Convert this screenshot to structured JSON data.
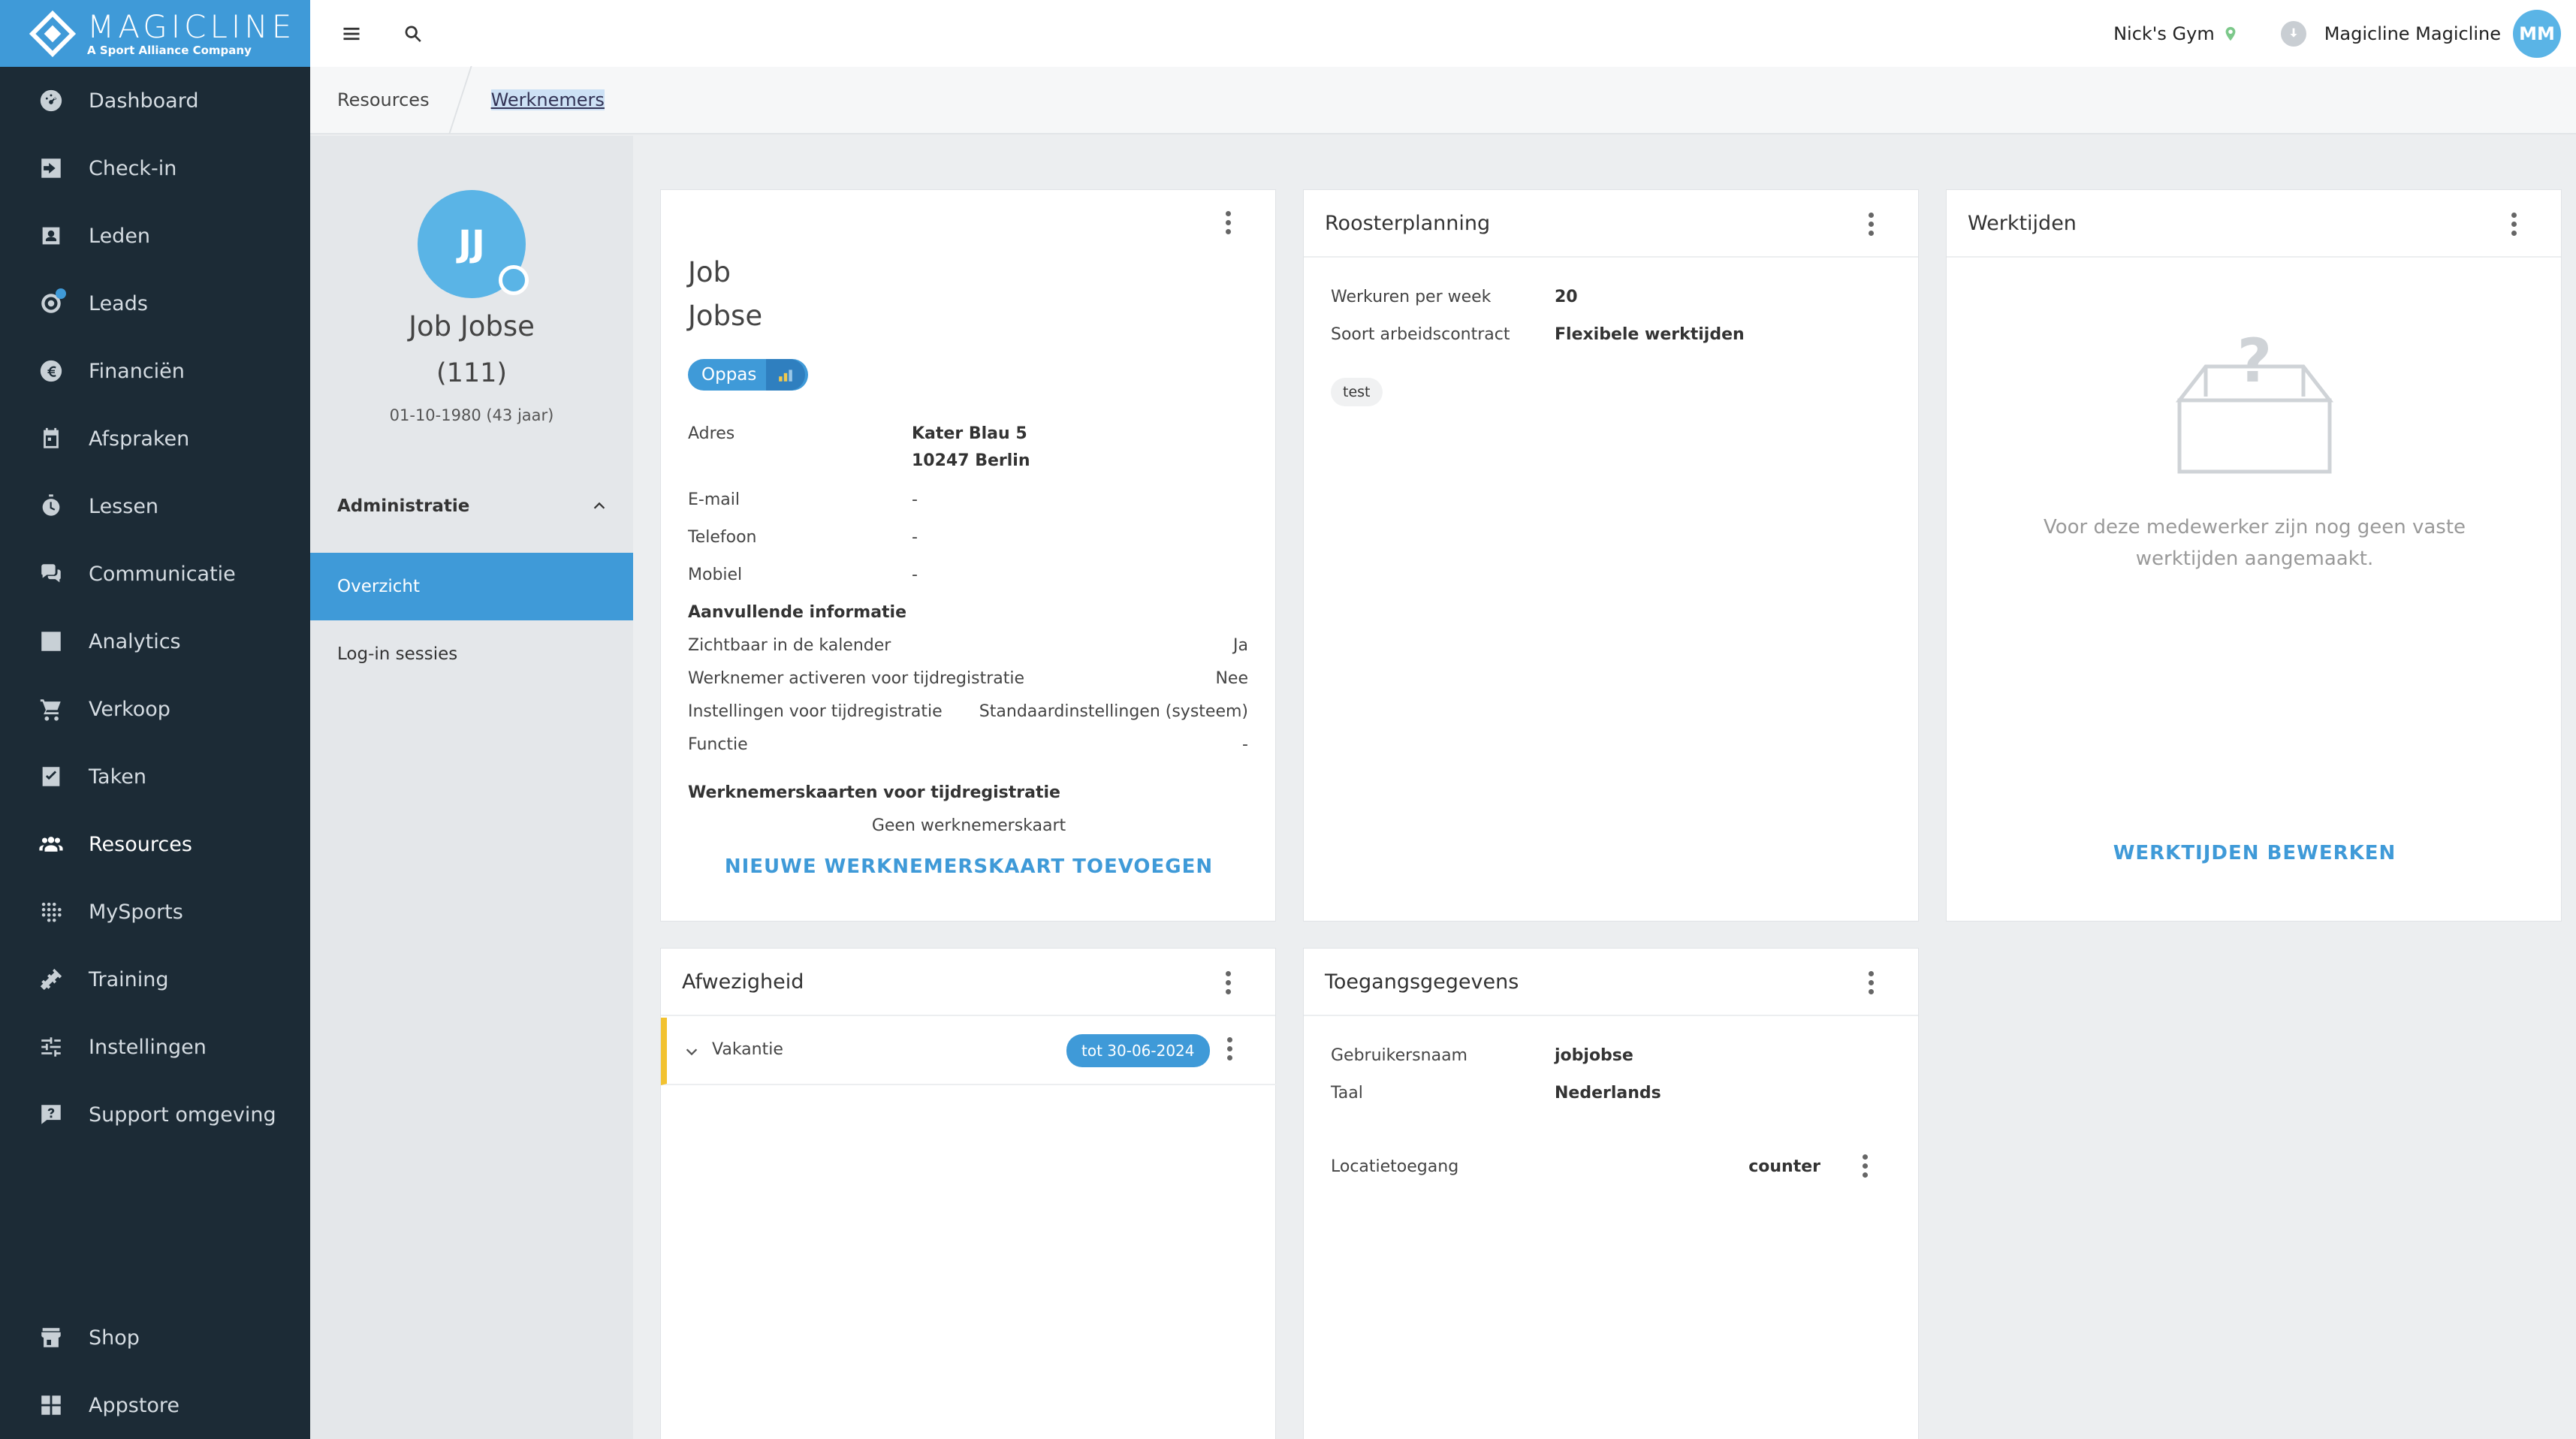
{
  "brand": {
    "name": "MAGICLINE",
    "tagline": "A Sport Alliance Company",
    "accent": "#3f9ad8",
    "sidebar_bg": "#1c2b36"
  },
  "sidebar": {
    "items": [
      {
        "label": "Dashboard",
        "icon": "dashboard-icon"
      },
      {
        "label": "Check-in",
        "icon": "checkin-icon"
      },
      {
        "label": "Leden",
        "icon": "members-icon"
      },
      {
        "label": "Leads",
        "icon": "leads-icon"
      },
      {
        "label": "Financiën",
        "icon": "euro-icon"
      },
      {
        "label": "Afspraken",
        "icon": "calendar-icon"
      },
      {
        "label": "Lessen",
        "icon": "stopwatch-icon"
      },
      {
        "label": "Communicatie",
        "icon": "chat-icon"
      },
      {
        "label": "Analytics",
        "icon": "chart-icon"
      },
      {
        "label": "Verkoop",
        "icon": "cart-icon"
      },
      {
        "label": "Taken",
        "icon": "task-icon"
      },
      {
        "label": "Resources",
        "icon": "people-icon"
      },
      {
        "label": "MySports",
        "icon": "grid-dots-icon"
      },
      {
        "label": "Training",
        "icon": "dumbbell-icon"
      },
      {
        "label": "Instellingen",
        "icon": "sliders-icon"
      },
      {
        "label": "Support omgeving",
        "icon": "support-icon"
      }
    ],
    "bottom": [
      {
        "label": "Shop",
        "icon": "shop-icon"
      },
      {
        "label": "Appstore",
        "icon": "apps-icon"
      }
    ]
  },
  "topbar": {
    "gym": "Nick's Gym",
    "user": "Magicline Magicline",
    "initials": "MM"
  },
  "breadcrumb": {
    "parent": "Resources",
    "current": "Werknemers"
  },
  "profile": {
    "initials": "JJ",
    "name": "Job Jobse",
    "number": "(111)",
    "dob": "01-10-1980 (43 jaar)",
    "section": "Administratie",
    "menu": [
      "Overzicht",
      "Log-in sessies"
    ]
  },
  "employee": {
    "first": "Job",
    "last": "Jobse",
    "role_pill": "Oppas",
    "address_label": "Adres",
    "address_line1": "Kater Blau 5",
    "address_line2": "10247 Berlin",
    "email_label": "E-mail",
    "email": "-",
    "phone_label": "Telefoon",
    "phone": "-",
    "mobile_label": "Mobiel",
    "mobile": "-",
    "extra_title": "Aanvullende informatie",
    "extra": [
      {
        "label": "Zichtbaar in de kalender",
        "value": "Ja"
      },
      {
        "label": "Werknemer activeren voor tijdregistratie",
        "value": "Nee"
      },
      {
        "label": "Instellingen voor tijdregistratie",
        "value": "Standaardinstellingen (systeem)"
      },
      {
        "label": "Functie",
        "value": "-"
      }
    ],
    "cards_title": "Werknemerskaarten voor tijdregistratie",
    "no_card": "Geen werknemerskaart",
    "add_card": "NIEUWE WERKNEMERSKAART TOEVOEGEN"
  },
  "rooster": {
    "title": "Roosterplanning",
    "hours_label": "Werkuren per week",
    "hours": "20",
    "contract_label": "Soort arbeidscontract",
    "contract": "Flexibele werktijden",
    "tag": "test"
  },
  "werktijden": {
    "title": "Werktijden",
    "empty": "Voor deze medewerker zijn nog geen vaste werktijden aangemaakt.",
    "edit": "WERKTIJDEN BEWERKEN"
  },
  "absence": {
    "title": "Afwezigheid",
    "item": "Vakantie",
    "until": "tot 30-06-2024"
  },
  "access": {
    "title": "Toegangsgegevens",
    "user_label": "Gebruikersnaam",
    "user": "jobjobse",
    "lang_label": "Taal",
    "lang": "Nederlands",
    "loc_label": "Locatietoegang",
    "loc": "counter"
  }
}
